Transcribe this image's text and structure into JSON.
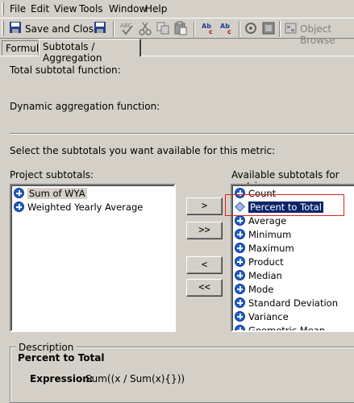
{
  "menu": {
    "file": "File",
    "edit": "Edit",
    "view": "View",
    "tools": "Tools",
    "window": "Window",
    "help": "Help"
  },
  "toolbar": {
    "save_close": "Save and Close",
    "object_browser": "Object Browse"
  },
  "tabs": [
    "Formula",
    "Subtotals / Aggregation"
  ],
  "labels": {
    "total_subtotal_function": "Total subtotal function:",
    "dynamic_aggregation_function": "Dynamic aggregation function:",
    "select_instruction": "Select the subtotals you want available for this metric:",
    "project_subtotals": "Project subtotals:",
    "available_subtotals": "Available subtotals for metric:"
  },
  "project_subtotals": [
    {
      "label": "Sum of WYA",
      "icon": "plus-icon",
      "selected": true
    },
    {
      "label": "Weighted Yearly Average",
      "icon": "plus-icon",
      "selected": false
    }
  ],
  "available_subtotals": [
    {
      "label": "Count",
      "icon": "plus-icon"
    },
    {
      "label": "Percent to Total",
      "icon": "diamond-icon",
      "selected": true
    },
    {
      "label": "Average",
      "icon": "plus-icon"
    },
    {
      "label": "Minimum",
      "icon": "plus-icon"
    },
    {
      "label": "Maximum",
      "icon": "plus-icon"
    },
    {
      "label": "Product",
      "icon": "plus-icon"
    },
    {
      "label": "Median",
      "icon": "plus-icon"
    },
    {
      "label": "Mode",
      "icon": "plus-icon"
    },
    {
      "label": "Standard Deviation",
      "icon": "plus-icon"
    },
    {
      "label": "Variance",
      "icon": "plus-icon"
    },
    {
      "label": "Geometric Mean",
      "icon": "plus-icon"
    }
  ],
  "buttons": {
    "add": ">",
    "add_all": ">>",
    "remove": "<",
    "remove_all": "<<"
  },
  "description": {
    "legend": "Description",
    "title": "Percent to Total",
    "expression_label": "Expression:",
    "expression_value": "Sum((x / Sum(x){}))"
  },
  "colors": {
    "window_bg": "#d4d0c8",
    "selection_blue": "#0a246a",
    "highlight_box": "#e02020"
  }
}
